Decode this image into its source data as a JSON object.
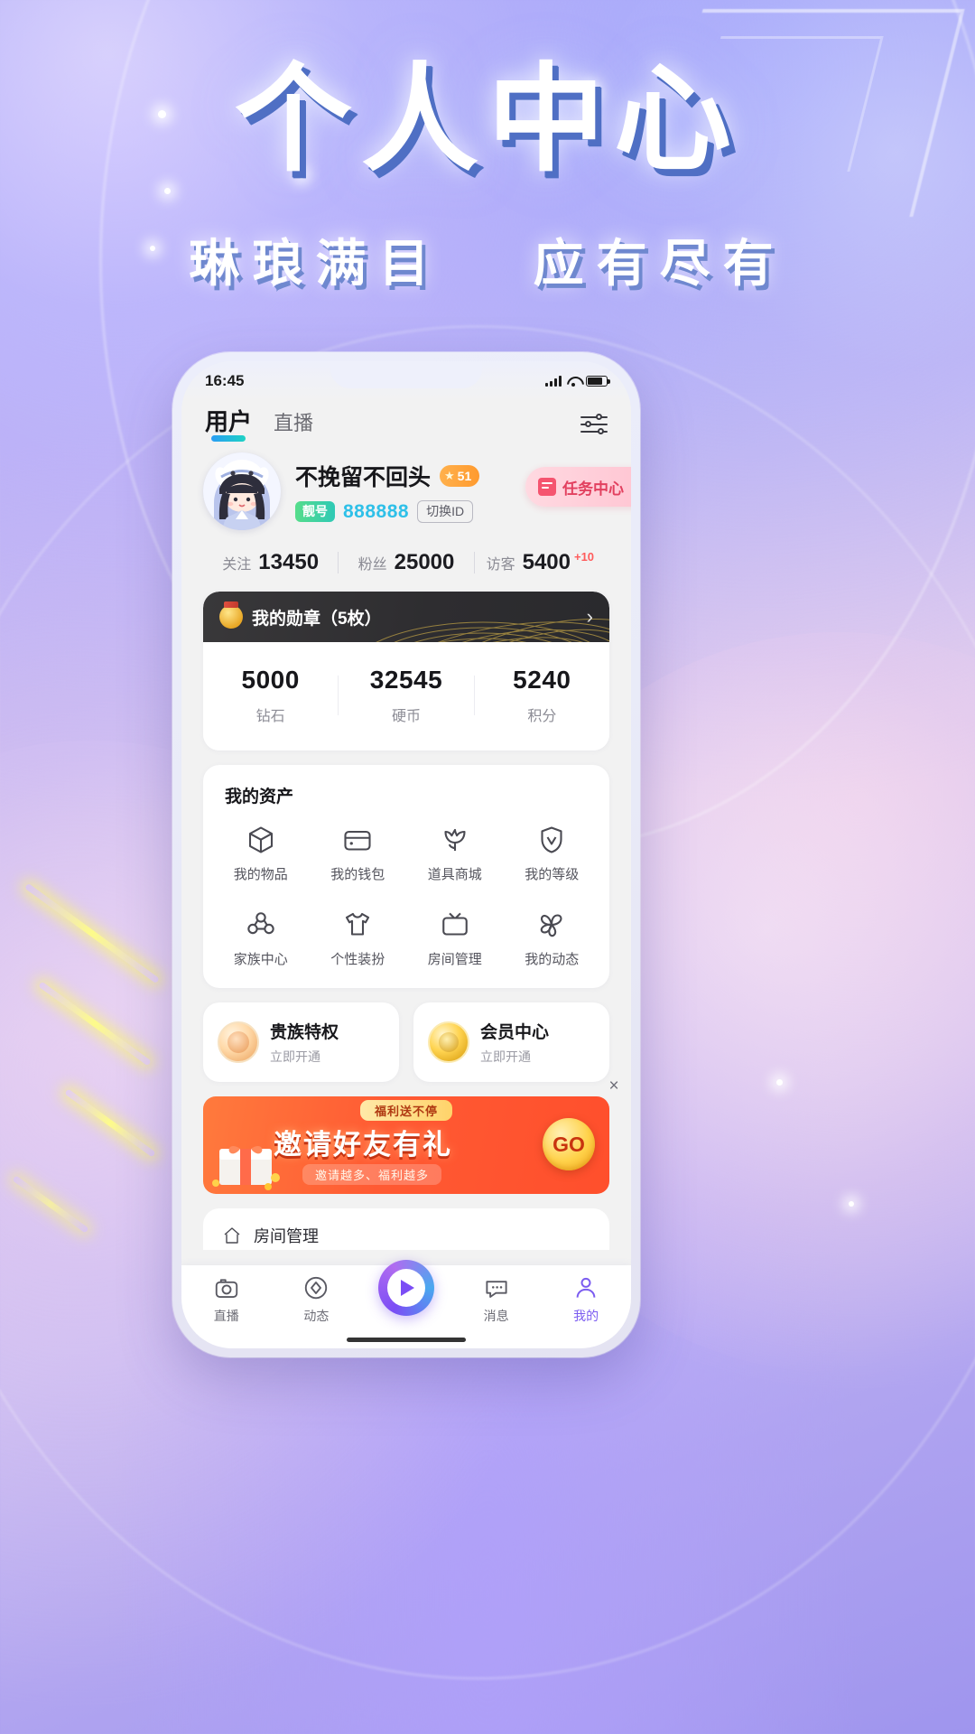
{
  "hero": {
    "title": "个人中心",
    "subtitle_left": "琳琅满目",
    "subtitle_right": "应有尽有"
  },
  "phone": {
    "status_bar": {
      "time": "16:45"
    },
    "top_tabs": [
      {
        "label": "用户",
        "active": true
      },
      {
        "label": "直播",
        "active": false
      }
    ],
    "filter_icon": "sliders-icon",
    "profile": {
      "username": "不挽留不回头",
      "level": "51",
      "liang_tag": "靓号",
      "id_number": "888888",
      "switch_id": "切换ID",
      "task_center": "任务中心"
    },
    "stats": [
      {
        "label": "关注",
        "value": "13450",
        "delta": ""
      },
      {
        "label": "粉丝",
        "value": "25000",
        "delta": ""
      },
      {
        "label": "访客",
        "value": "5400",
        "delta": "+10"
      }
    ],
    "medal": {
      "title": "我的勋章（5枚）",
      "arrow": "chevron-right-icon"
    },
    "wallet": [
      {
        "value": "5000",
        "label": "钻石"
      },
      {
        "value": "32545",
        "label": "硬币"
      },
      {
        "value": "5240",
        "label": "积分"
      }
    ],
    "assets": {
      "title": "我的资产",
      "items": [
        {
          "label": "我的物品",
          "icon": "box-icon"
        },
        {
          "label": "我的钱包",
          "icon": "wallet-icon"
        },
        {
          "label": "道具商城",
          "icon": "tulip-icon"
        },
        {
          "label": "我的等级",
          "icon": "shield-check-icon"
        },
        {
          "label": "家族中心",
          "icon": "family-icon"
        },
        {
          "label": "个性装扮",
          "icon": "tshirt-icon"
        },
        {
          "label": "房间管理",
          "icon": "tv-icon"
        },
        {
          "label": "我的动态",
          "icon": "pinwheel-icon"
        }
      ]
    },
    "privileges": [
      {
        "title": "贵族特权",
        "subtitle": "立即开通",
        "icon": "noble-badge-icon"
      },
      {
        "title": "会员中心",
        "subtitle": "立即开通",
        "icon": "vip-badge-icon"
      }
    ],
    "banner": {
      "ribbon": "福利送不停",
      "main": "邀请好友有礼",
      "sub": "邀请越多、福利越多",
      "cta": "GO",
      "close": "×"
    },
    "partial_row": {
      "label": "房间管理",
      "icon": "house-icon"
    },
    "bottom_nav": [
      {
        "label": "直播",
        "icon": "camera-icon",
        "active": false
      },
      {
        "label": "动态",
        "icon": "diamond-icon",
        "active": false
      },
      {
        "label": "",
        "icon": "play-button-icon",
        "active": false
      },
      {
        "label": "消息",
        "icon": "message-icon",
        "active": false
      },
      {
        "label": "我的",
        "icon": "person-icon",
        "active": true
      }
    ]
  },
  "colors": {
    "accent_purple": "#7b5cf0",
    "tab_underline_from": "#2a9df4",
    "tab_underline_to": "#1fd3c4",
    "id_cyan": "#2fc0e8",
    "level_orange": "#ff9a2e",
    "liang_green": "#2fc9b5",
    "task_pink": "#e2405f",
    "banner_orange": "#ff5a33"
  }
}
